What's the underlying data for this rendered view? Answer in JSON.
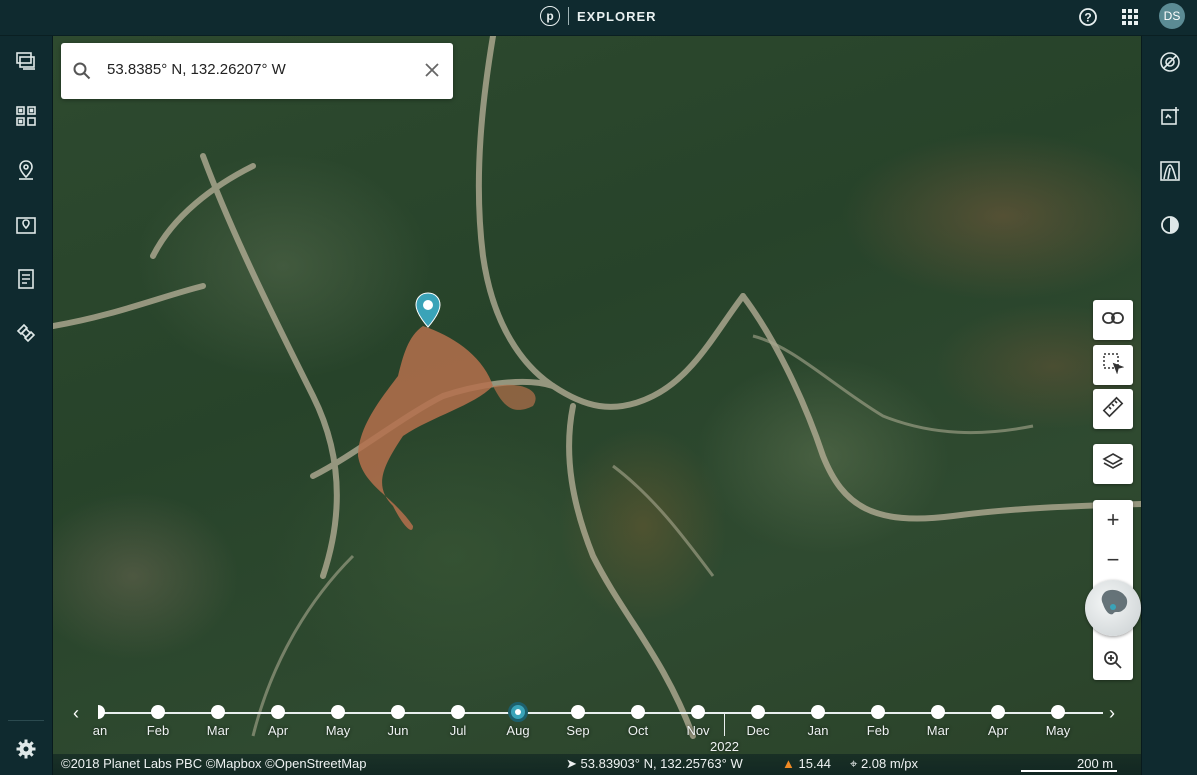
{
  "header": {
    "logo_letter": "p",
    "title": "EXPLORER",
    "user_initials": "DS",
    "icons": [
      "help-icon",
      "apps-grid-icon"
    ]
  },
  "left_sidebar": {
    "items": [
      {
        "name": "mosaics-icon"
      },
      {
        "name": "tiles-icon"
      },
      {
        "name": "places-icon"
      },
      {
        "name": "map-pin-icon"
      },
      {
        "name": "notes-icon"
      },
      {
        "name": "satellite-icon"
      }
    ],
    "settings_icon": "gear-icon"
  },
  "right_sidebar": {
    "items": [
      {
        "name": "compare-icon"
      },
      {
        "name": "enhance-icon"
      },
      {
        "name": "spectral-icon"
      },
      {
        "name": "contrast-icon"
      }
    ]
  },
  "search": {
    "value": "53.8385° N, 132.26207° W"
  },
  "map_controls": {
    "buttons": [
      "link-icon",
      "select-area-icon",
      "ruler-icon",
      "layers-icon"
    ],
    "zoom_in": "+",
    "zoom_out": "−"
  },
  "timeline": {
    "months": [
      "Jan",
      "Feb",
      "Mar",
      "Apr",
      "May",
      "Jun",
      "Jul",
      "Aug",
      "Sep",
      "Oct",
      "Nov",
      "Dec",
      "Jan",
      "Feb",
      "Mar",
      "Apr",
      "May"
    ],
    "first_label_visible": "an",
    "selected_month": "Aug",
    "year_label": "2022"
  },
  "status": {
    "attribution": "©2018 Planet Labs PBC ©Mapbox ©OpenStreetMap",
    "cursor_coords": "53.83903° N, 132.25763° W",
    "warning_value": "15.44",
    "resolution": "2.08 m/px",
    "scale": "200 m"
  },
  "colors": {
    "chrome": "#0f2a2f",
    "accent": "#3aa3b8",
    "warning": "#f08a24"
  }
}
